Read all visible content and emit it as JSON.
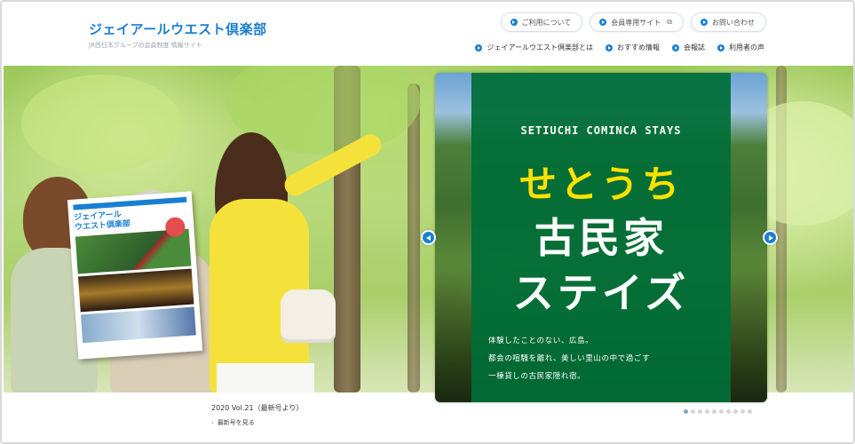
{
  "header": {
    "logo_title": "ジェイアールウエスト倶楽部",
    "logo_sub": "JR西日本グループの会員制度 情報サイト",
    "util_links": [
      {
        "label": "ご利用について"
      },
      {
        "label": "会員専用サイト",
        "external": true
      },
      {
        "label": "お問い合わせ"
      }
    ],
    "nav": [
      {
        "label": "ジェイアールウエスト倶楽部とは"
      },
      {
        "label": "おすすめ情報"
      },
      {
        "label": "会報誌"
      },
      {
        "label": "利用者の声"
      }
    ]
  },
  "magazine": {
    "title_line1": "ジェイアール",
    "title_line2": "ウエスト倶楽部"
  },
  "caption": {
    "volume": "2020 Vol.21（最新号より）",
    "link": "最新号を見る"
  },
  "slide": {
    "en_title": "SETIUCHI COMINCA STAYS",
    "yellow_title": "せとうち",
    "white_line1": "古民家",
    "white_line2": "ステイズ",
    "desc": [
      "体験したことのない、広島。",
      "都会の喧騒を離れ、美しい里山の中で過ごす",
      "一棟貸しの古民家隠れ宿。"
    ]
  },
  "carousel": {
    "dot_count": 10,
    "active_index": 0
  },
  "colors": {
    "brand_blue": "#1a7fd1",
    "slide_green": "#006e37",
    "slide_yellow": "#ffe100"
  }
}
